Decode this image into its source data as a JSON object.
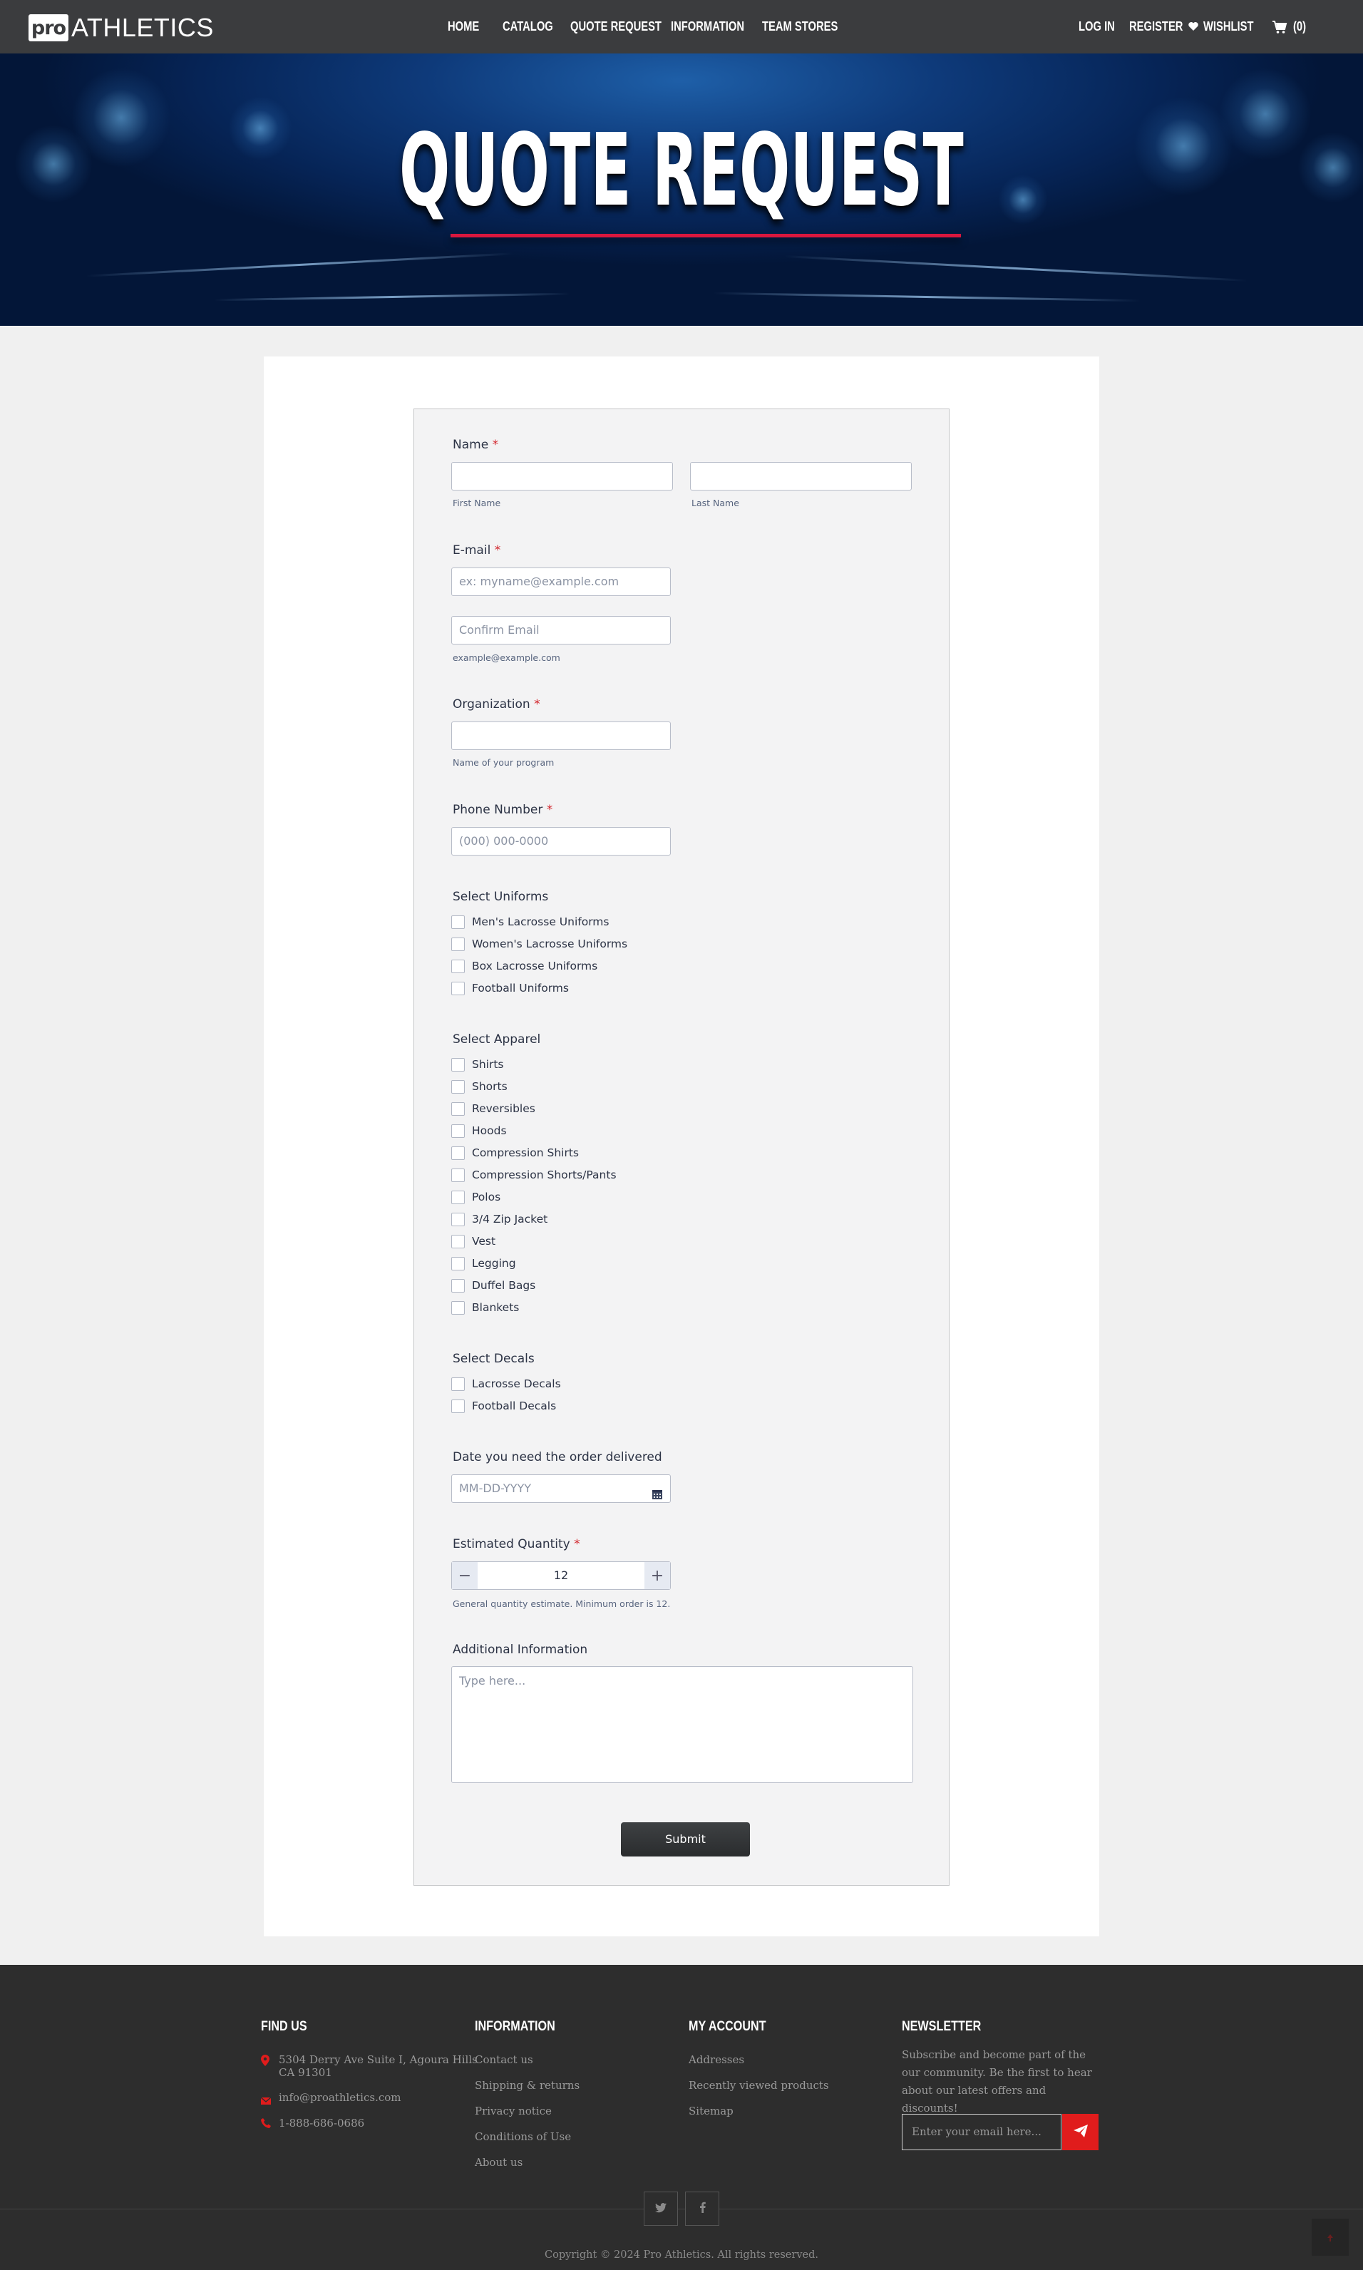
{
  "header": {
    "logo_mark": "pro",
    "logo_text": "ATHLETICS",
    "nav": [
      "HOME",
      "CATALOG",
      "QUOTE REQUEST",
      "INFORMATION",
      "TEAM STORES"
    ],
    "login": "LOG IN",
    "register": "REGISTER",
    "wishlist": "WISHLIST",
    "cart_count": "(0)"
  },
  "hero": {
    "title": "QUOTE REQUEST"
  },
  "form": {
    "name_label": "Name",
    "first_name_sub": "First Name",
    "last_name_sub": "Last Name",
    "email_label": "E-mail",
    "email_placeholder": "ex: myname@example.com",
    "confirm_email_placeholder": "Confirm Email",
    "email_sub": "example@example.com",
    "organization_label": "Organization",
    "organization_sub": "Name of your program",
    "phone_label": "Phone Number",
    "phone_placeholder": "(000) 000-0000",
    "uniforms_label": "Select Uniforms",
    "uniforms": [
      "Men's Lacrosse Uniforms",
      "Women's Lacrosse Uniforms",
      "Box Lacrosse Uniforms",
      "Football Uniforms"
    ],
    "apparel_label": "Select Apparel",
    "apparel": [
      "Shirts",
      "Shorts",
      "Reversibles",
      "Hoods",
      "Compression Shirts",
      "Compression Shorts/Pants",
      "Polos",
      "3/4 Zip Jacket",
      "Vest",
      "Legging",
      "Duffel Bags",
      "Blankets"
    ],
    "decals_label": "Select Decals",
    "decals": [
      "Lacrosse Decals",
      "Football Decals"
    ],
    "date_label": "Date you need the order delivered",
    "date_placeholder": "MM-DD-YYYY",
    "quantity_label": "Estimated Quantity",
    "quantity_value": "12",
    "quantity_minus": "−",
    "quantity_plus": "+",
    "quantity_sub": "General quantity estimate. Minimum order is 12.",
    "additional_label": "Additional Information",
    "additional_placeholder": "Type here...",
    "submit": "Submit",
    "required_mark": "*"
  },
  "footer": {
    "find_us": {
      "title": "FIND US",
      "address_line1": "5304 Derry Ave Suite I, Agoura Hills",
      "address_line2": "CA 91301",
      "email": "info@proathletics.com",
      "phone": "1-888-686-0686"
    },
    "information": {
      "title": "INFORMATION",
      "links": [
        "Contact us",
        "Shipping & returns",
        "Privacy notice",
        "Conditions of Use",
        "About us"
      ]
    },
    "my_account": {
      "title": "MY ACCOUNT",
      "links": [
        "Addresses",
        "Recently viewed products",
        "Sitemap"
      ]
    },
    "newsletter": {
      "title": "NEWSLETTER",
      "text": "Subscribe and become part of the our community. Be the first to hear about our latest offers and discounts!",
      "placeholder": "Enter your email here..."
    },
    "copyright": "Copyright © 2024 Pro Athletics. All rights reserved."
  },
  "colors": {
    "header_bg": "#3b3c3e",
    "accent_red": "#d9173e",
    "footer_bg": "#2d2d2d",
    "newsletter_button": "#e01c1c"
  }
}
